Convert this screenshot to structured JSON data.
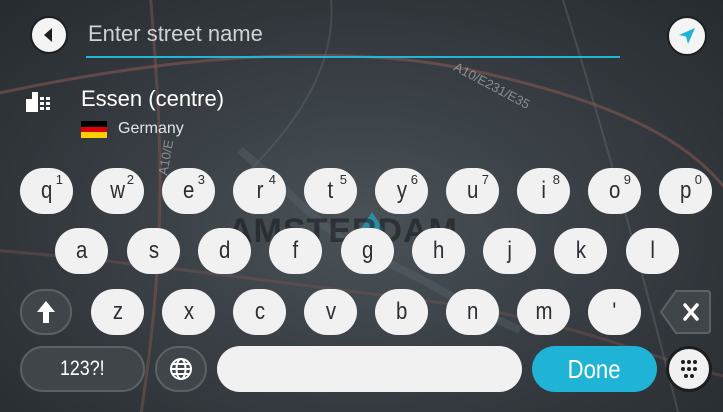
{
  "search": {
    "placeholder": "Enter street name",
    "value": ""
  },
  "suggestion": {
    "title": "Essen (centre)",
    "country": "Germany"
  },
  "map": {
    "road_label": "A10/E231/E35",
    "road_label_2": "A10/E",
    "city_label": "AMSTERDAM"
  },
  "keyboard": {
    "row1": [
      {
        "key": "q",
        "hint": "1"
      },
      {
        "key": "w",
        "hint": "2"
      },
      {
        "key": "e",
        "hint": "3"
      },
      {
        "key": "r",
        "hint": "4"
      },
      {
        "key": "t",
        "hint": "5"
      },
      {
        "key": "y",
        "hint": "6"
      },
      {
        "key": "u",
        "hint": "7"
      },
      {
        "key": "i",
        "hint": "8"
      },
      {
        "key": "o",
        "hint": "9"
      },
      {
        "key": "p",
        "hint": "0"
      }
    ],
    "row2": [
      "a",
      "s",
      "d",
      "f",
      "g",
      "h",
      "j",
      "k",
      "l"
    ],
    "row3": [
      "z",
      "x",
      "c",
      "v",
      "b",
      "n",
      "m",
      "'"
    ],
    "numbers_label": "123?!",
    "done_label": "Done"
  },
  "colors": {
    "accent": "#1fb3d6",
    "key_bg": "#f1f1f1",
    "flag": [
      "#000000",
      "#dd0000",
      "#ffce00"
    ]
  }
}
